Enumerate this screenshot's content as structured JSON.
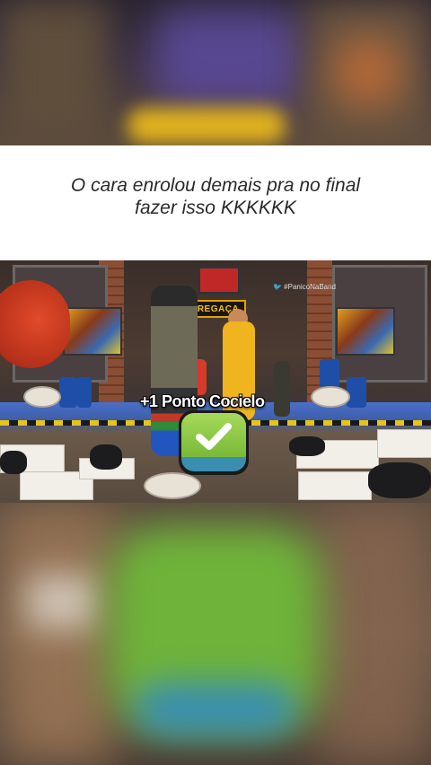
{
  "caption": {
    "line1": "O cara enrolou demais pra no final",
    "line2": "fazer isso KKKKKK"
  },
  "video": {
    "sign_text": "REGAÇA",
    "watermark_handle": "🐦 #PanicoNaBand",
    "overlay_points": "+1 Ponto Cocielo",
    "badge_icon": "check-icon",
    "colors": {
      "badge_green": "#6cb12e",
      "badge_blue": "#3a8fb0",
      "sign_yellow": "#f2c20e"
    }
  }
}
